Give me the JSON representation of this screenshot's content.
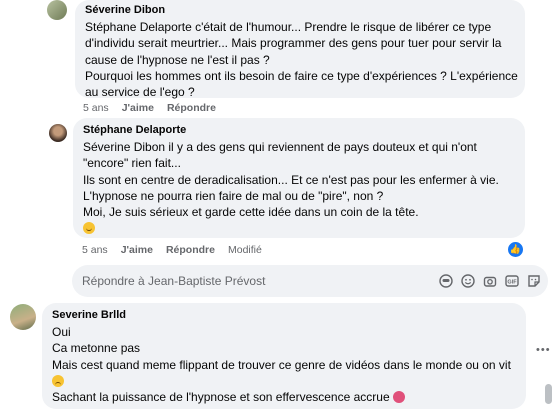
{
  "comments": [
    {
      "author": "Séverine Dibon",
      "lines": [
        "Stéphane Delaporte c'était de l'humour... Prendre le risque de libérer ce type",
        "d'individu serait meurtrier... Mais programmer des gens pour tuer pour servir la",
        "cause de l'hypnose ne l'est il pas ?",
        "Pourquoi les hommes ont ils besoin de faire ce type d'expériences ? L'expérience",
        "au service de l'ego ?"
      ],
      "time": "5 ans",
      "like": "J'aime",
      "reply": "Répondre"
    },
    {
      "author": "Stéphane Delaporte",
      "lines": [
        "Séverine Dibon il y a des gens qui reviennent de pays douteux et qui n'ont",
        "\"encore\" rien fait...",
        "Ils sont en centre de deradicalisation... Et ce n'est pas pour les enfermer à vie.",
        "L'hypnose ne pourra rien faire de mal ou de \"pire\", non ?",
        "Moi, Je suis sérieux et garde cette idée dans un coin de la tête."
      ],
      "emoji": "sweat-smile",
      "time": "5 ans",
      "like": "J'aime",
      "reply": "Répondre",
      "edited": "Modifié",
      "reaction": "like"
    },
    {
      "author": "Severine Brlld",
      "lines": [
        "Oui",
        "Ca metonne pas",
        "Mais cest quand meme flippant de trouver ce genre de vidéos dans le monde ou on vit"
      ],
      "emoji": "sad",
      "last_line": "Sachant la puissance de l'hypnose et son effervescence accrue",
      "last_emoji": "hot-face"
    }
  ],
  "reply_box": {
    "placeholder": "Répondre à Jean-Baptiste Prévost",
    "icons": [
      "sticker-icon",
      "emoji-icon",
      "camera-icon",
      "gif-icon",
      "sticker-alt-icon"
    ]
  },
  "more_icon": "ellipsis-icon",
  "colors": {
    "bubble": "#f0f2f5",
    "meta": "#65676b",
    "like": "#1877f2"
  }
}
